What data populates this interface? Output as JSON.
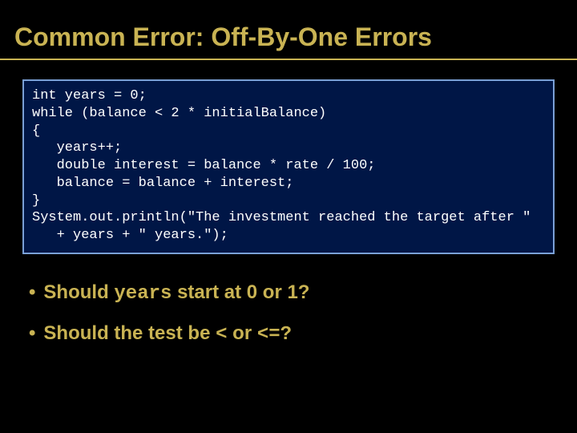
{
  "title": "Common Error: Off-By-One Errors",
  "code": "int years = 0;\nwhile (balance < 2 * initialBalance)\n{\n   years++;\n   double interest = balance * rate / 100;\n   balance = balance + interest;\n}\nSystem.out.println(\"The investment reached the target after \"\n   + years + \" years.\");",
  "bullets": {
    "b1": {
      "pre": "Should ",
      "code": "years",
      "post": " start at 0 or 1?"
    },
    "b2": {
      "pre": "Should the test be ",
      "code1": "<",
      "mid": " or ",
      "code2": "<=?"
    }
  }
}
